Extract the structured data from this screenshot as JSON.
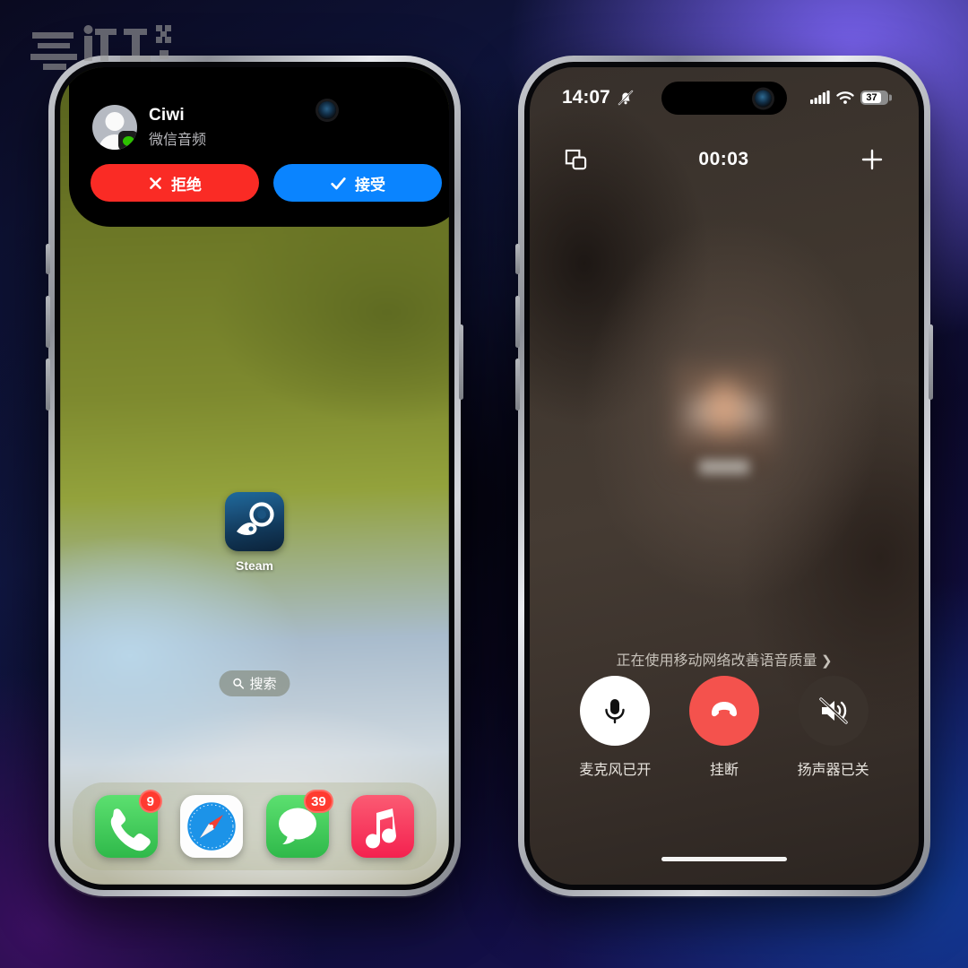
{
  "background": {
    "accent_purple": "#7a63f0",
    "accent_blue": "#123a95",
    "accent_dark": "#0a0a20"
  },
  "watermark": {
    "label": "zoliti-logo"
  },
  "left_phone": {
    "name": "home-screen-with-incoming-call",
    "incoming_call": {
      "caller_name": "Ciwi",
      "call_type": "微信音频",
      "avatar_icon": "person-placeholder-icon",
      "app_badge_icon": "wechat-icon",
      "decline_label": "拒绝",
      "decline_icon": "x-icon",
      "decline_color": "#fa2b25",
      "accept_label": "接受",
      "accept_icon": "check-icon",
      "accept_color": "#0a84ff"
    },
    "app_icon": {
      "label": "Steam",
      "icon": "steam-icon"
    },
    "search": {
      "label": "搜索",
      "icon": "search-icon"
    },
    "dock": [
      {
        "name": "phone",
        "icon": "phone-icon",
        "badge": "9",
        "color": "#4cd964"
      },
      {
        "name": "safari",
        "icon": "safari-compass-icon",
        "badge": "",
        "color": "#ffffff"
      },
      {
        "name": "messages",
        "icon": "message-bubble-icon",
        "badge": "39",
        "color": "#4cd964"
      },
      {
        "name": "music",
        "icon": "music-note-icon",
        "badge": "",
        "color": "#fa2d55"
      }
    ]
  },
  "right_phone": {
    "name": "active-voice-call-screen",
    "status_bar": {
      "time": "14:07",
      "silent_icon": "bell-slash-icon",
      "signal_icon": "cellular-bars-icon",
      "wifi_icon": "wifi-icon",
      "battery_percent": "37"
    },
    "top_bar": {
      "minimize_icon": "picture-in-picture-icon",
      "timer": "00:03",
      "add_icon": "plus-icon"
    },
    "network_hint": "正在使用移动网络改善语音质量",
    "network_hint_chevron": "chevron-right-icon",
    "controls": [
      {
        "label": "麦克风已开",
        "icon": "microphone-icon",
        "style": "light"
      },
      {
        "label": "挂断",
        "icon": "phone-down-icon",
        "style": "danger"
      },
      {
        "label": "扬声器已关",
        "icon": "speaker-muted-icon",
        "style": "dark"
      }
    ]
  }
}
